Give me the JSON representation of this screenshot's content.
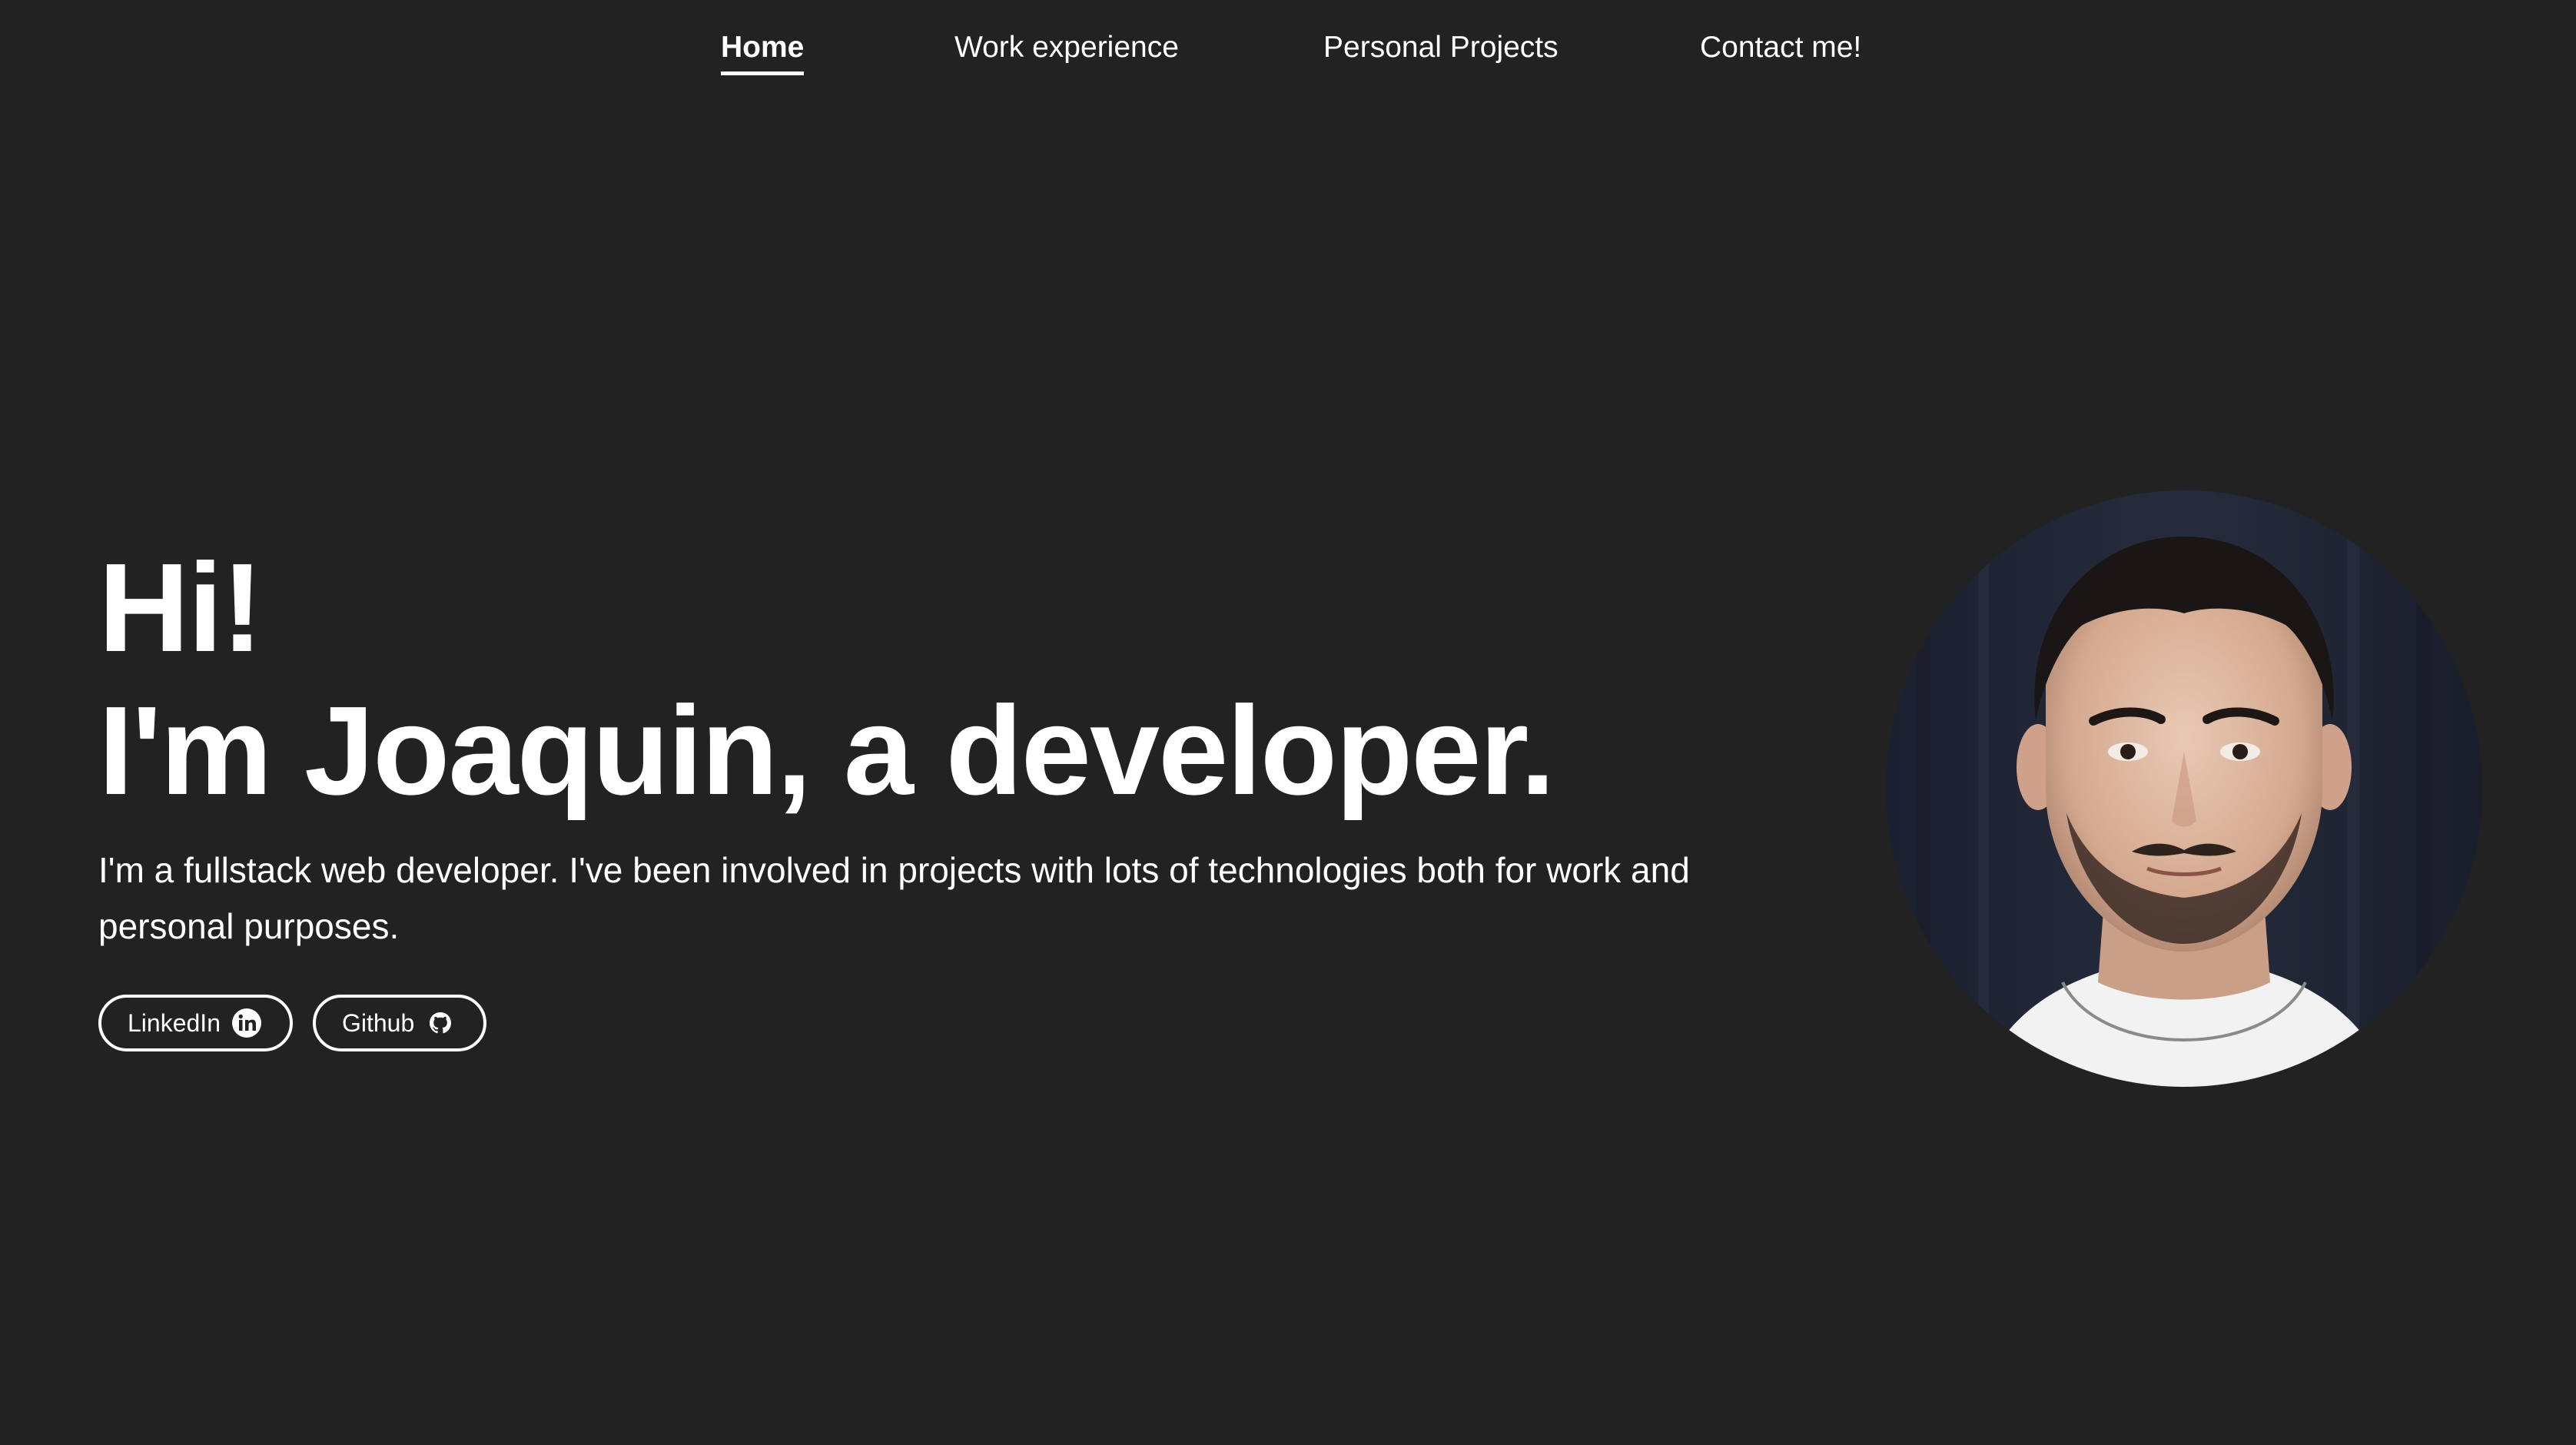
{
  "nav": {
    "items": [
      {
        "label": "Home",
        "active": true
      },
      {
        "label": "Work experience",
        "active": false
      },
      {
        "label": "Personal Projects",
        "active": false
      },
      {
        "label": "Contact me!",
        "active": false
      }
    ]
  },
  "hero": {
    "title_line1": "Hi!",
    "title_line2": "I'm Joaquin, a developer.",
    "description": "I'm a fullstack web developer. I've been involved in projects with lots of technologies both for work and personal purposes.",
    "buttons": [
      {
        "label": "LinkedIn",
        "icon": "linkedin-icon"
      },
      {
        "label": "Github",
        "icon": "github-icon"
      }
    ]
  },
  "avatar": {
    "alt": "profile photo"
  },
  "colors": {
    "background": "#222222",
    "text": "#ffffff"
  }
}
